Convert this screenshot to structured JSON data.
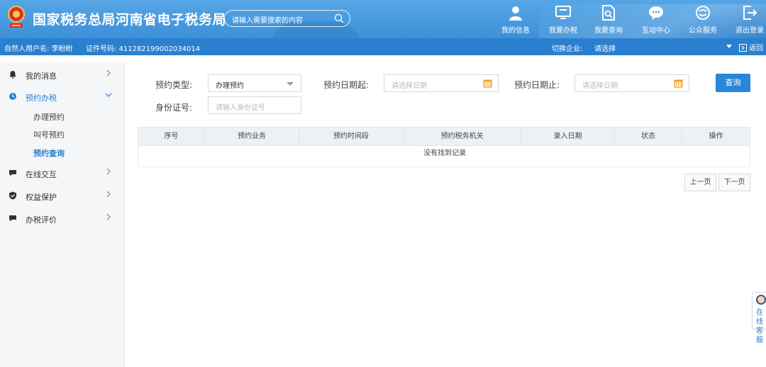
{
  "header": {
    "title": "国家税务总局河南省电子税务局",
    "search_placeholder": "请输入需要搜索的内容",
    "nav": [
      {
        "label": "我的信息",
        "icon": "user-icon"
      },
      {
        "label": "我要办税",
        "icon": "monitor-icon"
      },
      {
        "label": "我要查询",
        "icon": "search-doc-icon"
      },
      {
        "label": "互动中心",
        "icon": "chat-icon"
      },
      {
        "label": "公众服务",
        "icon": "public-service-icon"
      },
      {
        "label": "退出登录",
        "icon": "logout-icon"
      }
    ]
  },
  "subbar": {
    "user": "自然人用户名: 李盼盼",
    "cert": "证件号码: 411282199002034014",
    "switch_label": "切换企业:",
    "switch_value": "请选择",
    "back": "返回"
  },
  "sidebar": {
    "items": [
      {
        "label": "我的消息",
        "icon": "bell-icon",
        "expanded": false
      },
      {
        "label": "预约办税",
        "icon": "clock-icon",
        "expanded": true,
        "children": [
          {
            "label": "办理预约",
            "active": false
          },
          {
            "label": "叫号预约",
            "active": false
          },
          {
            "label": "预约查询",
            "active": true
          }
        ]
      },
      {
        "label": "在线交互",
        "icon": "chat-bubble-icon",
        "expanded": false
      },
      {
        "label": "权益保护",
        "icon": "shield-icon",
        "expanded": false
      },
      {
        "label": "办税评价",
        "icon": "comment-icon",
        "expanded": false
      }
    ]
  },
  "form": {
    "type_label": "预约类型:",
    "type_value": "办理预约",
    "date_start_label": "预约日期起:",
    "date_start_placeholder": "请选择日期",
    "date_end_label": "预约日期止:",
    "date_end_placeholder": "请选择日期",
    "id_label": "身份证号:",
    "id_placeholder": "请输入身份证号",
    "query_button": "查询"
  },
  "table": {
    "columns": [
      "序号",
      "预约业务",
      "预约时间段",
      "预约税务机关",
      "录入日期",
      "状态",
      "操作"
    ],
    "rows": [],
    "empty_text": "没有找到记录"
  },
  "pager": {
    "prev": "上一页",
    "next": "下一页"
  },
  "customer_service": {
    "label": "在线客服"
  },
  "colors": {
    "header_blue": "#3d90d8",
    "subbar_blue": "#2b7fcf",
    "accent": "#2b86d9",
    "calendar_orange": "#f0a020"
  }
}
